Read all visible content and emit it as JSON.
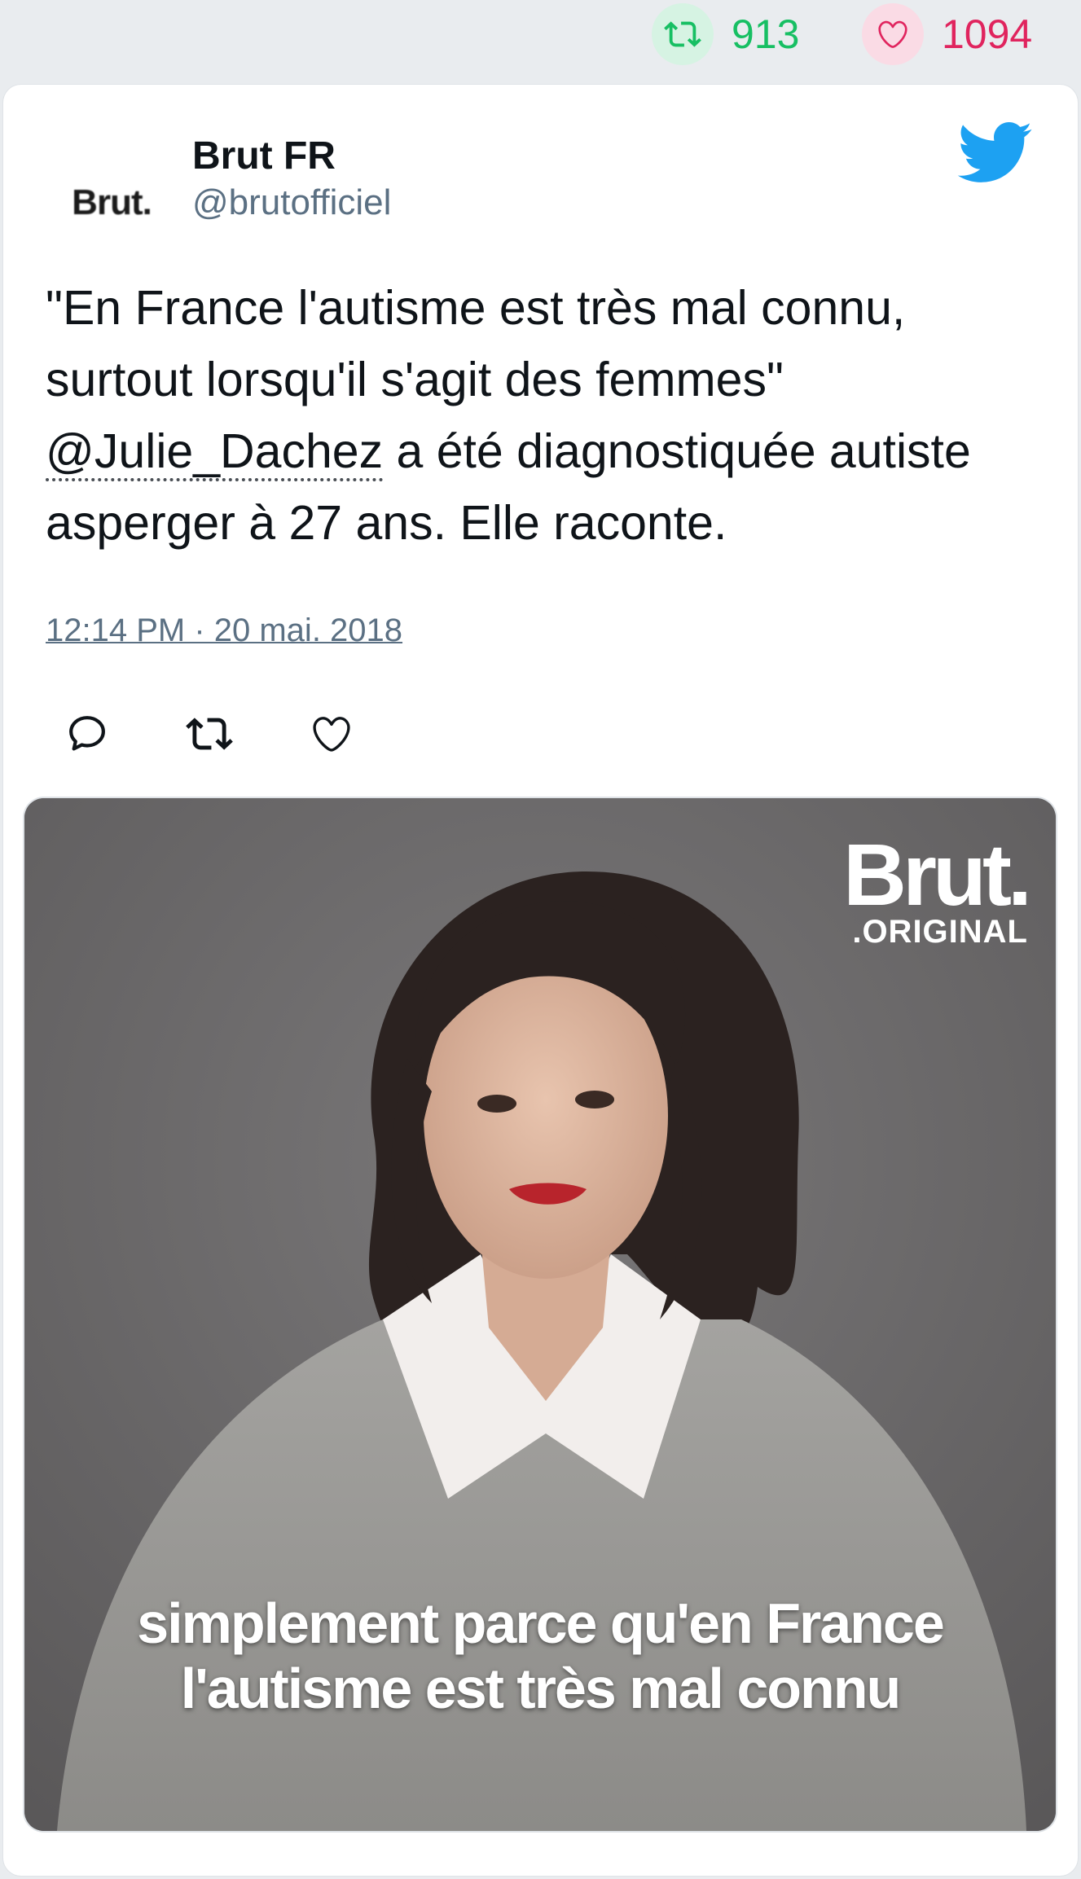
{
  "stats": {
    "retweets": "913",
    "likes": "1094",
    "retweet_icon": "retweet-icon",
    "like_icon": "heart-icon",
    "retweet_color": "#17bf63",
    "like_color": "#e0245e"
  },
  "tweet": {
    "avatar_text": "Brut.",
    "name": "Brut FR",
    "handle": "@brutofficiel",
    "text_part1": "\"En France l'autisme est très mal connu, surtout lorsqu'il s'agit des femmes\" ",
    "mention": "@Julie_Dachez",
    "text_part2": " a été diagnostiquée autiste asperger à 27 ans. Elle raconte.",
    "timestamp": "12:14 PM · 20 mai. 2018",
    "brand_icon": "twitter-bird-icon",
    "brand_color": "#1da1f2"
  },
  "actions": {
    "reply_icon": "reply-icon",
    "retweet_icon": "retweet-icon",
    "like_icon": "heart-icon"
  },
  "media": {
    "logo_main": "Brut.",
    "logo_sub": ".ORIGINAL",
    "caption_line1": "simplement parce qu'en France",
    "caption_line2": "l'autisme est très mal connu"
  }
}
